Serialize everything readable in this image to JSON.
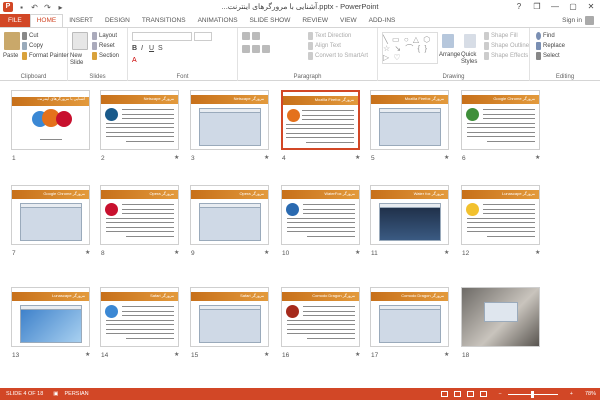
{
  "titlebar": {
    "title": "...آشنایی با مرورگرهای اینترنت.pptx - PowerPoint",
    "app_icon": "P",
    "qat": [
      "save-icon",
      "undo-icon",
      "redo-icon",
      "present-icon"
    ],
    "controls": [
      "?",
      "❐",
      "—",
      "▢",
      "✕"
    ]
  },
  "tabs": [
    {
      "label": "FILE",
      "kind": "file"
    },
    {
      "label": "HOME",
      "kind": "active"
    },
    {
      "label": "INSERT"
    },
    {
      "label": "DESIGN"
    },
    {
      "label": "TRANSITIONS"
    },
    {
      "label": "ANIMATIONS"
    },
    {
      "label": "SLIDE SHOW"
    },
    {
      "label": "REVIEW"
    },
    {
      "label": "VIEW"
    },
    {
      "label": "ADD-INS"
    }
  ],
  "signin": "Sign in",
  "ribbon": {
    "clipboard": {
      "label": "Clipboard",
      "paste": "Paste",
      "cut": "Cut",
      "copy": "Copy",
      "format_painter": "Format Painter"
    },
    "slides": {
      "label": "Slides",
      "new_slide": "New Slide",
      "layout": "Layout",
      "reset": "Reset",
      "section": "Section"
    },
    "font": {
      "label": "Font"
    },
    "paragraph": {
      "label": "Paragraph",
      "text_direction": "Text Direction",
      "align_text": "Align Text",
      "smartart": "Convert to SmartArt"
    },
    "drawing": {
      "label": "Drawing",
      "arrange": "Arrange",
      "quick_styles": "Quick Styles",
      "shape_fill": "Shape Fill",
      "shape_outline": "Shape Outline",
      "shape_effects": "Shape Effects"
    },
    "editing": {
      "label": "Editing",
      "find": "Find",
      "replace": "Replace",
      "select": "Select"
    }
  },
  "slides": [
    {
      "n": "1",
      "title": "آشنایی با مرورگرهای اینترنت",
      "kind": "cover",
      "star": false
    },
    {
      "n": "2",
      "title": "Netscape مرورگر",
      "kind": "logo-text",
      "logo": "#1a5a8a",
      "star": true
    },
    {
      "n": "3",
      "title": "Netscape مرورگر",
      "kind": "shot",
      "star": true
    },
    {
      "n": "4",
      "title": "Mozilla Firefox مرورگر",
      "kind": "logo-text",
      "logo": "#e4711c",
      "star": true,
      "selected": true
    },
    {
      "n": "5",
      "title": "Mozilla Firefox مرورگر",
      "kind": "shot",
      "star": true
    },
    {
      "n": "6",
      "title": "Google Chrome مرورگر",
      "kind": "logo-text",
      "logo": "#3f8f3a",
      "star": true
    },
    {
      "n": "7",
      "title": "Google Chrome مرورگر",
      "kind": "shot",
      "star": true
    },
    {
      "n": "8",
      "title": "Opera مرورگر",
      "kind": "logo-text",
      "logo": "#c8102e",
      "star": true
    },
    {
      "n": "9",
      "title": "Opera مرورگر",
      "kind": "shot",
      "star": true
    },
    {
      "n": "10",
      "title": "WaterFox مرورگر",
      "kind": "logo-text",
      "logo": "#2a6ab0",
      "star": true
    },
    {
      "n": "11",
      "title": "Water fox مرورگر",
      "kind": "shot-dark",
      "star": true
    },
    {
      "n": "12",
      "title": "Lunascape مرورگر",
      "kind": "logo-text",
      "logo": "#f2c12e",
      "star": true
    },
    {
      "n": "13",
      "title": "Lunascape مرورگر",
      "kind": "shot-blue",
      "star": true
    },
    {
      "n": "14",
      "title": "Safari مرورگر",
      "kind": "logo-text",
      "logo": "#3b88d4",
      "star": true
    },
    {
      "n": "15",
      "title": "Safari مرورگر",
      "kind": "shot",
      "star": true
    },
    {
      "n": "16",
      "title": "Comodo Dragon مرورگر",
      "kind": "logo-text",
      "logo": "#a52a1c",
      "star": true
    },
    {
      "n": "17",
      "title": "Comodo Dragon مرورگر",
      "kind": "shot",
      "star": true
    },
    {
      "n": "18",
      "title": "",
      "kind": "photo",
      "star": false
    }
  ],
  "status": {
    "slide": "SLIDE 4 OF 18",
    "language": "PERSIAN",
    "zoom": "78%",
    "zoom_fraction": 0.5
  },
  "colors": {
    "accent": "#d24726",
    "band": "#d4821f"
  }
}
